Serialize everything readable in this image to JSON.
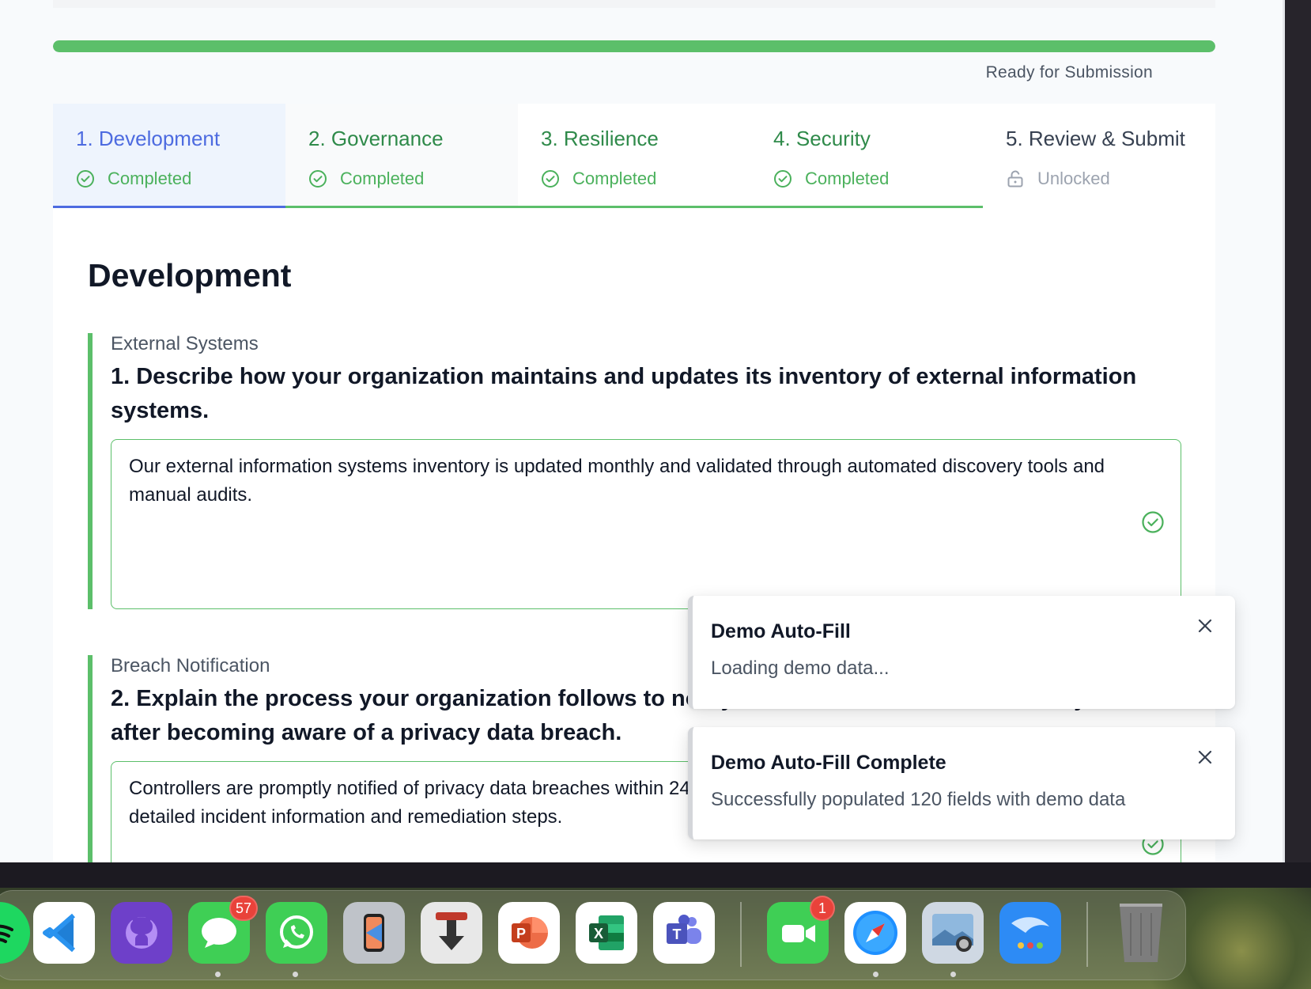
{
  "progress": {
    "percent": 100,
    "status": "Ready for Submission"
  },
  "tabs": [
    {
      "title": "1. Development",
      "status": "Completed",
      "icon": "check-circle-icon"
    },
    {
      "title": "2. Governance",
      "status": "Completed",
      "icon": "check-circle-icon"
    },
    {
      "title": "3. Resilience",
      "status": "Completed",
      "icon": "check-circle-icon"
    },
    {
      "title": "4. Security",
      "status": "Completed",
      "icon": "check-circle-icon"
    },
    {
      "title": "5. Review & Submit",
      "status": "Unlocked",
      "icon": "unlock-icon"
    }
  ],
  "section": {
    "title": "Development",
    "questions": [
      {
        "category": "External Systems",
        "text": "1. Describe how your organization maintains and updates its inventory of external information systems.",
        "answer": "Our external information systems inventory is updated monthly and validated through automated discovery tools and manual audits."
      },
      {
        "category": "Breach Notification",
        "text": "2. Explain the process your organization follows to notify controllers without undue delay after becoming aware of a privacy data breach.",
        "answer": "Controllers are promptly notified of privacy data breaches within 24 hours via our incident response system, including detailed incident information and remediation steps."
      }
    ]
  },
  "toasts": [
    {
      "title": "Demo Auto-Fill",
      "message": "Loading demo data..."
    },
    {
      "title": "Demo Auto-Fill Complete",
      "message": "Successfully populated 120 fields with demo data"
    }
  ],
  "dock": {
    "apps": [
      {
        "name": "Spotify",
        "icon": "spotify-icon",
        "color": "#1ed760"
      },
      {
        "name": "Visual Studio Code",
        "icon": "vscode-icon",
        "color": "#ffffff"
      },
      {
        "name": "GitHub Desktop",
        "icon": "github-icon",
        "color": "#6e40c9"
      },
      {
        "name": "Messages",
        "icon": "messages-icon",
        "color": "#3fcf55",
        "badge": "57"
      },
      {
        "name": "WhatsApp",
        "icon": "whatsapp-icon",
        "color": "#3fcf55"
      },
      {
        "name": "iPhone Mirroring",
        "icon": "iphone-icon",
        "color": "#bfc3c9"
      },
      {
        "name": "Transmission",
        "icon": "download-icon",
        "color": "#e8e8e8"
      },
      {
        "name": "PowerPoint",
        "icon": "powerpoint-icon",
        "color": "#ffffff"
      },
      {
        "name": "Excel",
        "icon": "excel-icon",
        "color": "#ffffff"
      },
      {
        "name": "Teams",
        "icon": "teams-icon",
        "color": "#ffffff"
      },
      {
        "name": "FaceTime",
        "icon": "facetime-icon",
        "color": "#3fcf55",
        "badge": "1"
      },
      {
        "name": "Safari",
        "icon": "safari-icon",
        "color": "#ffffff"
      },
      {
        "name": "Preview",
        "icon": "preview-icon",
        "color": "#cfd8e3"
      },
      {
        "name": "Instruments",
        "icon": "app-icon",
        "color": "#2d8bf5"
      },
      {
        "name": "Trash",
        "icon": "trash-icon",
        "color": "#7d7d7d"
      }
    ]
  }
}
